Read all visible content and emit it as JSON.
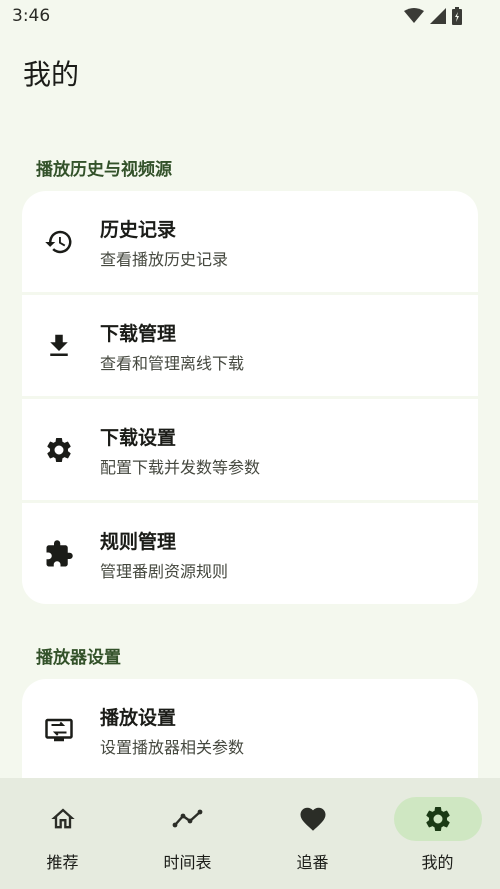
{
  "status": {
    "time": "3:46"
  },
  "page": {
    "title": "我的"
  },
  "sections": [
    {
      "title": "播放历史与视频源",
      "items": [
        {
          "title": "历史记录",
          "subtitle": "查看播放历史记录",
          "icon": "history-icon"
        },
        {
          "title": "下载管理",
          "subtitle": "查看和管理离线下载",
          "icon": "download-icon"
        },
        {
          "title": "下载设置",
          "subtitle": "配置下载并发数等参数",
          "icon": "gear-icon"
        },
        {
          "title": "规则管理",
          "subtitle": "管理番剧资源规则",
          "icon": "puzzle-icon"
        }
      ]
    },
    {
      "title": "播放器设置",
      "items": [
        {
          "title": "播放设置",
          "subtitle": "设置播放器相关参数",
          "icon": "player-settings-icon"
        }
      ]
    }
  ],
  "nav": {
    "items": [
      {
        "label": "推荐",
        "icon": "home-icon",
        "active": false
      },
      {
        "label": "时间表",
        "icon": "timeline-icon",
        "active": false
      },
      {
        "label": "追番",
        "icon": "heart-icon",
        "active": false
      },
      {
        "label": "我的",
        "icon": "gear-icon",
        "active": true
      }
    ]
  },
  "colors": {
    "background": "#f4f8ee",
    "accent": "#33522a",
    "active_pill": "#cfe7c2",
    "nav_background": "#e6ebdf"
  }
}
